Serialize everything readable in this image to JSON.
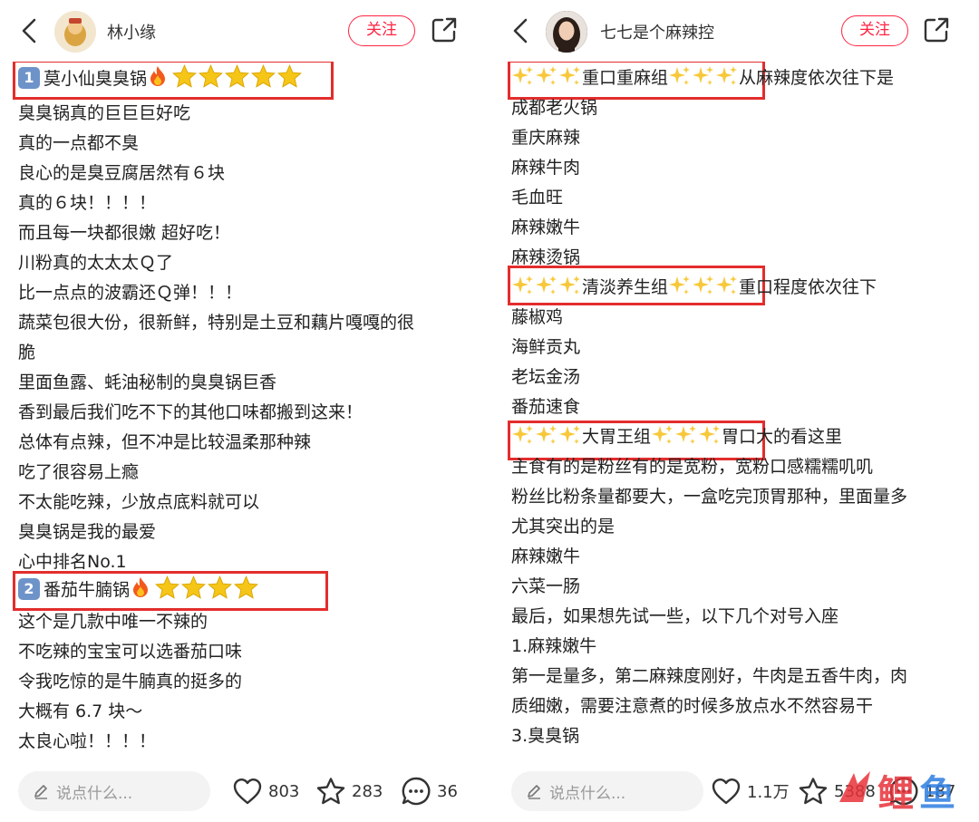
{
  "left": {
    "username": "林小缘",
    "follow_label": "关注",
    "section1": {
      "badge": "1",
      "title": "莫小仙臭臭锅"
    },
    "lines_a": [
      "臭臭锅真的巨巨巨好吃",
      "真的一点都不臭",
      "良心的是臭豆腐居然有６块",
      "真的６块！！！！",
      "而且每一块都很嫩 超好吃！",
      "川粉真的太太太Ｑ了",
      "比一点点的波霸还Ｑ弹！！！",
      "蔬菜包很大份，很新鲜，特别是土豆和藕片嘎嘎的很",
      "脆",
      "里面鱼露、蚝油秘制的臭臭锅巨香",
      "香到最后我们吃不下的其他口味都搬到这来！",
      "总体有点辣，但不冲是比较温柔那种辣",
      "吃了很容易上瘾",
      "不太能吃辣，少放点底料就可以",
      "臭臭锅是我的最爱",
      "心中排名No.1"
    ],
    "section2": {
      "badge": "2",
      "title": "番茄牛腩锅"
    },
    "lines_b": [
      "这个是几款中唯一不辣的",
      "不吃辣的宝宝可以选番茄口味",
      "令我吃惊的是牛腩真的挺多的",
      "大概有 6.7 块～",
      "太良心啦！！！！"
    ],
    "comment_placeholder": "说点什么...",
    "likes": "803",
    "stars": "283",
    "comments": "36"
  },
  "right": {
    "username": "七七是个麻辣控",
    "follow_label": "关注",
    "group1": {
      "title": "重口重麻组",
      "suffix": "从麻辣度依次往下是"
    },
    "group1_items": [
      "成都老火锅",
      "重庆麻辣",
      "麻辣牛肉",
      "毛血旺",
      "麻辣嫩牛",
      "麻辣烫锅"
    ],
    "group2": {
      "title": "清淡养生组",
      "suffix": "重口程度依次往下"
    },
    "group2_items": [
      "藤椒鸡",
      "海鲜贡丸",
      "老坛金汤",
      "番茄速食"
    ],
    "group3": {
      "title": "大胃王组",
      "suffix": "胃口大的看这里"
    },
    "lines_c": [
      "主食有的是粉丝有的是宽粉，宽粉口感糯糯叽叽",
      "粉丝比粉条量都要大，一盒吃完顶胃那种，里面量多",
      "尤其突出的是",
      "麻辣嫩牛",
      "六菜一肠",
      "最后，如果想先试一些，以下几个对号入座",
      "1.麻辣嫩牛",
      "第一是量多，第二麻辣度刚好，牛肉是五香牛肉，肉",
      "质细嫩，需要注意煮的时候多放点水不然容易干",
      "3.臭臭锅"
    ],
    "comment_placeholder": "说点什么...",
    "likes": "1.1万",
    "stars": "5388",
    "comments": "187"
  },
  "watermark": {
    "char1": "鲤",
    "char2": "鱼"
  },
  "colors": {
    "accent": "#ff2442",
    "highlight_box": "#e32d2d",
    "badge": "#6e93c9",
    "star": "#f5c518"
  }
}
